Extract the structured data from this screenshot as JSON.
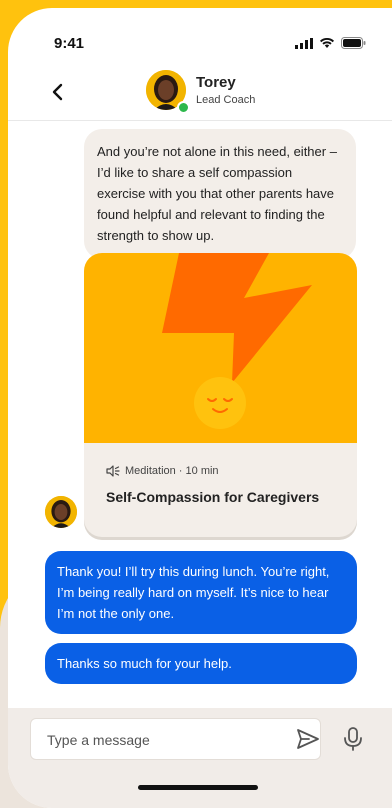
{
  "status_bar": {
    "time": "9:41"
  },
  "header": {
    "coach_name": "Torey",
    "coach_role": "Lead Coach"
  },
  "messages": {
    "incoming_text": "And you’re not alone in this need, either – I’d like to share a self compassion exercise with you that other parents have found helpful and relevant to finding the strength to show up.",
    "card": {
      "meta": "Meditation · 10 min",
      "title": "Self-Compassion for Caregivers"
    },
    "outgoing": [
      "Thank you! I’ll try this during lunch. You’re right, I’m being really hard on myself. It’s nice to hear I’m not the only one.",
      "Thanks so much for your help."
    ]
  },
  "composer": {
    "placeholder": "Type a message"
  },
  "colors": {
    "brand_yellow": "#ffc20e",
    "card_orange": "#ffb300",
    "bolt_orange": "#ff6a00",
    "outgoing_blue": "#0a60e6",
    "online_green": "#2db84c"
  }
}
